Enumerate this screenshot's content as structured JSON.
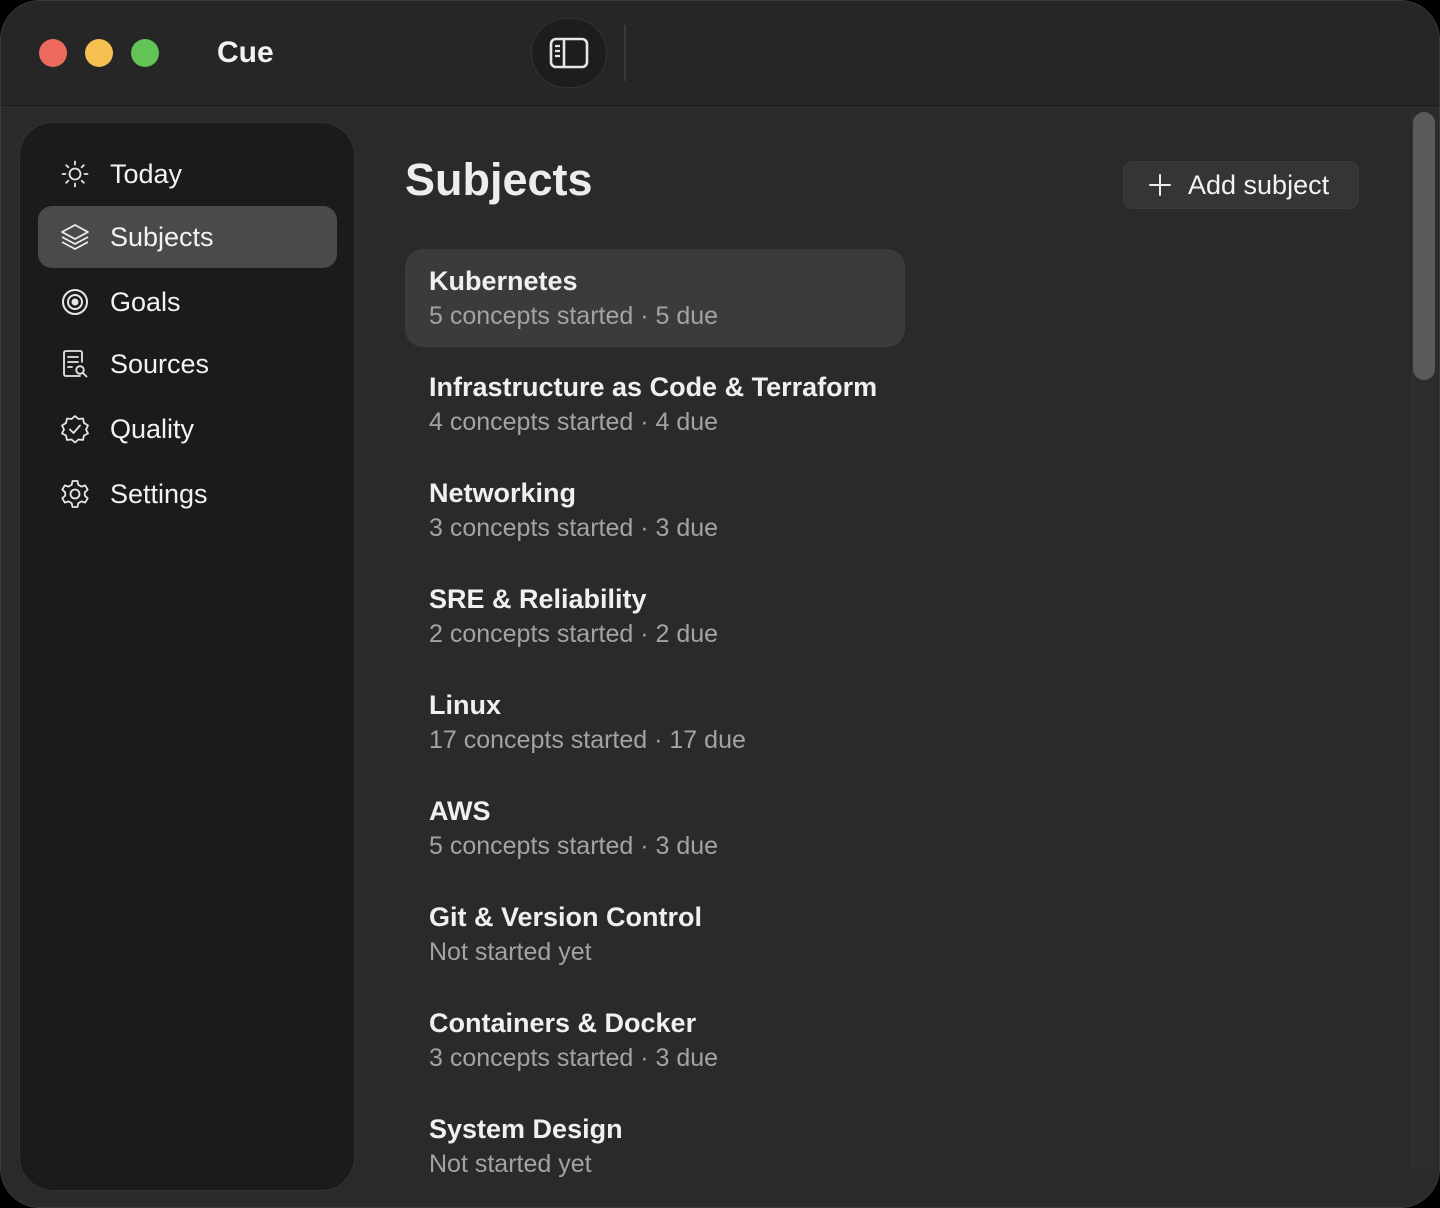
{
  "window": {
    "title": "Cue"
  },
  "sidebar": {
    "items": [
      {
        "label": "Today",
        "icon": "sun-icon",
        "active": false
      },
      {
        "label": "Subjects",
        "icon": "layers-icon",
        "active": true
      },
      {
        "label": "Goals",
        "icon": "target-icon",
        "active": false
      },
      {
        "label": "Sources",
        "icon": "document-search-icon",
        "active": false
      },
      {
        "label": "Quality",
        "icon": "badge-check-icon",
        "active": false
      },
      {
        "label": "Settings",
        "icon": "gear-icon",
        "active": false
      }
    ]
  },
  "main": {
    "title": "Subjects",
    "add_button_label": "Add subject",
    "subjects": [
      {
        "name": "Kubernetes",
        "meta": "5 concepts started · 5 due",
        "selected": true
      },
      {
        "name": "Infrastructure as Code & Terraform",
        "meta": "4 concepts started · 4 due",
        "selected": false
      },
      {
        "name": "Networking",
        "meta": "3 concepts started · 3 due",
        "selected": false
      },
      {
        "name": "SRE & Reliability",
        "meta": "2 concepts started · 2 due",
        "selected": false
      },
      {
        "name": "Linux",
        "meta": "17 concepts started · 17 due",
        "selected": false
      },
      {
        "name": "AWS",
        "meta": "5 concepts started · 3 due",
        "selected": false
      },
      {
        "name": "Git & Version Control",
        "meta": "Not started yet",
        "selected": false
      },
      {
        "name": "Containers & Docker",
        "meta": "3 concepts started · 3 due",
        "selected": false
      },
      {
        "name": "System Design",
        "meta": "Not started yet",
        "selected": false
      }
    ]
  },
  "colors": {
    "background": "#2a2a2a",
    "sidebar": "#1b1b1b",
    "selection": "#4a4a4a"
  }
}
